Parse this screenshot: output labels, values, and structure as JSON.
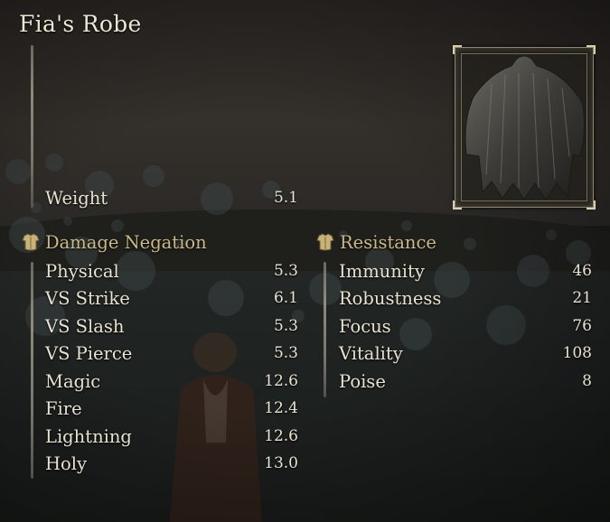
{
  "item": {
    "name": "Fia's Robe"
  },
  "weight": {
    "label": "Weight",
    "value": "5.1"
  },
  "damage_negation": {
    "title": "Damage Negation",
    "icon": "armor-chest-icon",
    "rows": [
      {
        "label": "Physical",
        "value": "5.3"
      },
      {
        "label": "VS Strike",
        "value": "6.1"
      },
      {
        "label": "VS Slash",
        "value": "5.3"
      },
      {
        "label": "VS Pierce",
        "value": "5.3"
      },
      {
        "label": "Magic",
        "value": "12.6"
      },
      {
        "label": "Fire",
        "value": "12.4"
      },
      {
        "label": "Lightning",
        "value": "12.6"
      },
      {
        "label": "Holy",
        "value": "13.0"
      }
    ]
  },
  "resistance": {
    "title": "Resistance",
    "icon": "armor-chest-icon",
    "rows": [
      {
        "label": "Immunity",
        "value": "46"
      },
      {
        "label": "Robustness",
        "value": "21"
      },
      {
        "label": "Focus",
        "value": "76"
      },
      {
        "label": "Vitality",
        "value": "108"
      },
      {
        "label": "Poise",
        "value": "8"
      }
    ]
  },
  "colors": {
    "text": "#e8e2d2",
    "header": "#cbb98a",
    "frame": "#8f8772"
  }
}
